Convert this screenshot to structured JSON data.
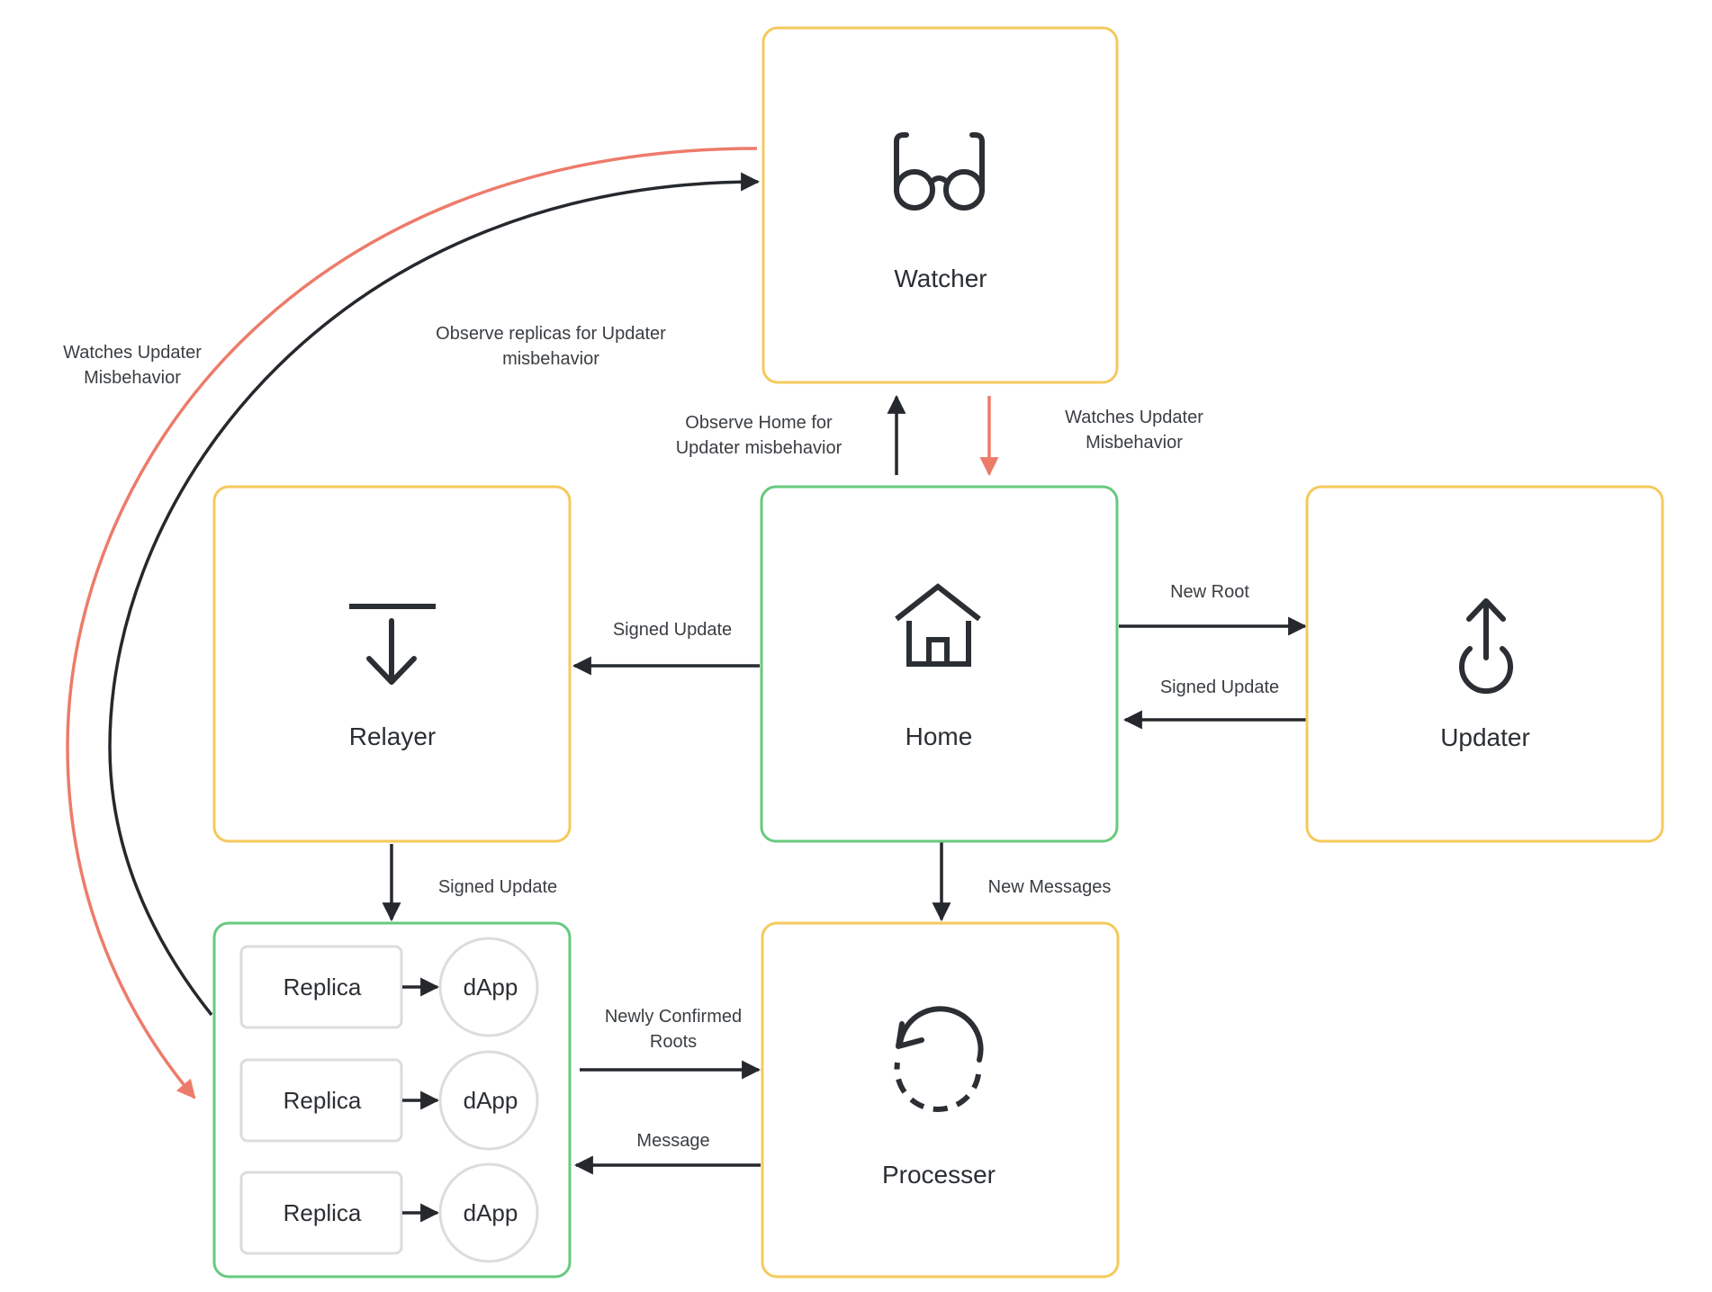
{
  "colors": {
    "component_border": "#F5C95C",
    "contract_border": "#67C97E",
    "edge_dark": "#25292D",
    "edge_red": "#ED7B6A",
    "sub_border": "#DCDCDC",
    "text": "#2B2F33"
  },
  "nodes": {
    "watcher": {
      "label": "Watcher",
      "icon": "glasses-icon",
      "kind": "agent"
    },
    "relayer": {
      "label": "Relayer",
      "icon": "download-arrow-icon",
      "kind": "agent"
    },
    "home": {
      "label": "Home",
      "icon": "house-icon",
      "kind": "contract"
    },
    "updater": {
      "label": "Updater",
      "icon": "power-upload-icon",
      "kind": "agent"
    },
    "processer": {
      "label": "Processer",
      "icon": "dashed-refresh-icon",
      "kind": "agent"
    },
    "replicas": {
      "kind": "contract",
      "rows": [
        {
          "replica": "Replica",
          "dapp": "dApp"
        },
        {
          "replica": "Replica",
          "dapp": "dApp"
        },
        {
          "replica": "Replica",
          "dapp": "dApp"
        }
      ]
    }
  },
  "edges": {
    "watcher_watches_replicas": {
      "from": "watcher",
      "to": "replicas",
      "color": "red",
      "label": [
        "Watches Updater",
        "Misbehavior"
      ]
    },
    "watcher_observes_replicas": {
      "from": "replicas",
      "to": "watcher",
      "color": "dark",
      "label": [
        "Observe replicas for Updater",
        "misbehavior"
      ]
    },
    "watcher_observes_home": {
      "from": "home",
      "to": "watcher",
      "color": "dark",
      "label": [
        "Observe Home for",
        "Updater misbehavior"
      ]
    },
    "watcher_watches_home": {
      "from": "watcher",
      "to": "home",
      "color": "red",
      "label": [
        "Watches Updater",
        "Misbehavior"
      ]
    },
    "home_to_relayer": {
      "from": "home",
      "to": "relayer",
      "color": "dark",
      "label": [
        "Signed Update"
      ]
    },
    "home_to_updater": {
      "from": "home",
      "to": "updater",
      "color": "dark",
      "label": [
        "New Root"
      ]
    },
    "updater_to_home": {
      "from": "updater",
      "to": "home",
      "color": "dark",
      "label": [
        "Signed Update"
      ]
    },
    "relayer_to_replicas": {
      "from": "relayer",
      "to": "replicas",
      "color": "dark",
      "label": [
        "Signed Update"
      ]
    },
    "home_to_processer": {
      "from": "home",
      "to": "processer",
      "color": "dark",
      "label": [
        "New Messages"
      ]
    },
    "replicas_to_processer": {
      "from": "replicas",
      "to": "processer",
      "color": "dark",
      "label": [
        "Newly Confirmed",
        "Roots"
      ]
    },
    "processer_to_replicas": {
      "from": "processer",
      "to": "replicas",
      "color": "dark",
      "label": [
        "Message"
      ]
    }
  }
}
